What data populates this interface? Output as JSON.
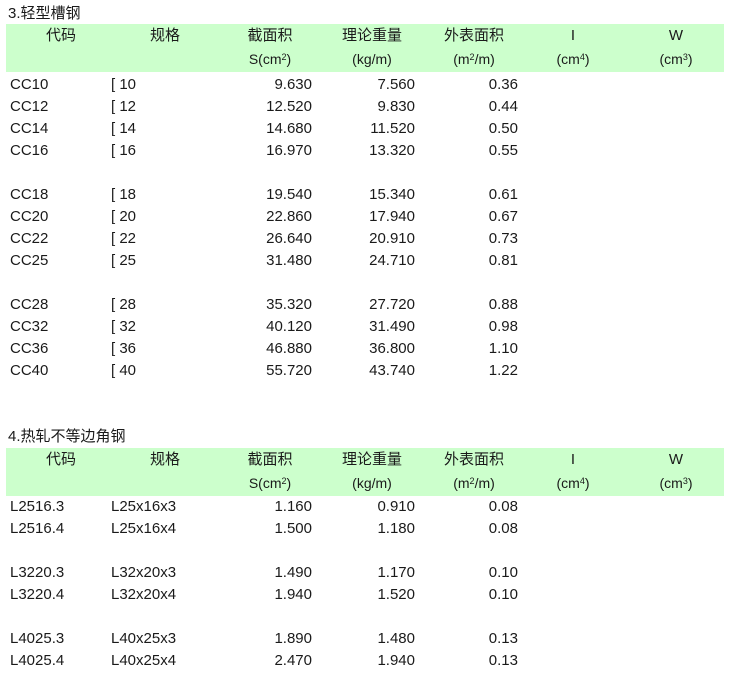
{
  "headers": {
    "code": "代码",
    "spec": "规格",
    "area": "截面积",
    "area_unit_pre": "S(cm",
    "area_unit_sup": "2",
    "area_unit_post": ")",
    "weight": "理论重量",
    "weight_unit": "(kg/m)",
    "surface": "外表面积",
    "surface_unit_pre": "(m",
    "surface_unit_sup": "2",
    "surface_unit_post": "/m)",
    "i": "I",
    "i_unit_pre": "(cm",
    "i_unit_sup": "4",
    "i_unit_post": ")",
    "w": "W",
    "w_unit_pre": "(cm",
    "w_unit_sup": "3",
    "w_unit_post": ")"
  },
  "sections": [
    {
      "title": "3.轻型槽钢",
      "rows": [
        {
          "code": "CC10",
          "spec": "[ 10",
          "area": "9.630",
          "weight": "7.560",
          "surface": "0.36"
        },
        {
          "code": "CC12",
          "spec": "[ 12",
          "area": "12.520",
          "weight": "9.830",
          "surface": "0.44"
        },
        {
          "code": "CC14",
          "spec": "[ 14",
          "area": "14.680",
          "weight": "11.520",
          "surface": "0.50"
        },
        {
          "code": "CC16",
          "spec": "[ 16",
          "area": "16.970",
          "weight": "13.320",
          "surface": "0.55"
        },
        {
          "code": "CC18",
          "spec": "[ 18",
          "area": "19.540",
          "weight": "15.340",
          "surface": "0.61"
        },
        {
          "code": "CC20",
          "spec": "[ 20",
          "area": "22.860",
          "weight": "17.940",
          "surface": "0.67"
        },
        {
          "code": "CC22",
          "spec": "[ 22",
          "area": "26.640",
          "weight": "20.910",
          "surface": "0.73"
        },
        {
          "code": "CC25",
          "spec": "[ 25",
          "area": "31.480",
          "weight": "24.710",
          "surface": "0.81"
        },
        {
          "code": "CC28",
          "spec": "[ 28",
          "area": "35.320",
          "weight": "27.720",
          "surface": "0.88"
        },
        {
          "code": "CC32",
          "spec": "[ 32",
          "area": "40.120",
          "weight": "31.490",
          "surface": "0.98"
        },
        {
          "code": "CC36",
          "spec": "[ 36",
          "area": "46.880",
          "weight": "36.800",
          "surface": "1.10"
        },
        {
          "code": "CC40",
          "spec": "[ 40",
          "area": "55.720",
          "weight": "43.740",
          "surface": "1.22"
        }
      ]
    },
    {
      "title": "4.热轧不等边角钢",
      "rows": [
        {
          "code": "L2516.3",
          "spec": "L25x16x3",
          "area": "1.160",
          "weight": "0.910",
          "surface": "0.08"
        },
        {
          "code": "L2516.4",
          "spec": "L25x16x4",
          "area": "1.500",
          "weight": "1.180",
          "surface": "0.08"
        },
        {
          "code": "L3220.3",
          "spec": "L32x20x3",
          "area": "1.490",
          "weight": "1.170",
          "surface": "0.10"
        },
        {
          "code": "L3220.4",
          "spec": "L32x20x4",
          "area": "1.940",
          "weight": "1.520",
          "surface": "0.10"
        },
        {
          "code": "L4025.3",
          "spec": "L40x25x3",
          "area": "1.890",
          "weight": "1.480",
          "surface": "0.13"
        },
        {
          "code": "L4025.4",
          "spec": "L40x25x4",
          "area": "2.470",
          "weight": "1.940",
          "surface": "0.13"
        }
      ]
    }
  ],
  "colors": {
    "header_bg": "#ccffcc",
    "text": "#1a1a1a"
  }
}
